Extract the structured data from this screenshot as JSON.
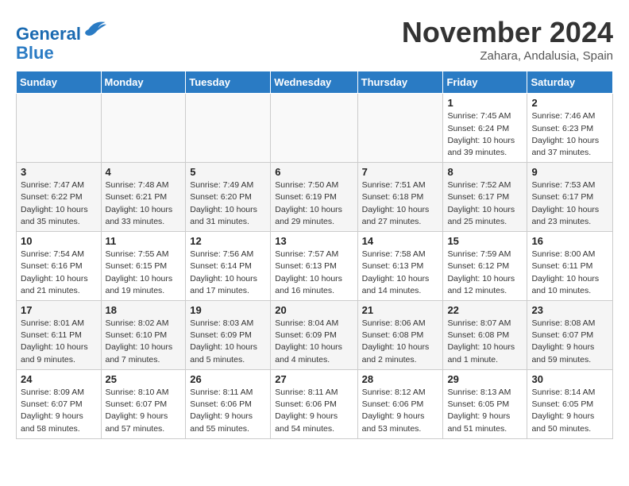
{
  "logo": {
    "line1": "General",
    "line2": "Blue"
  },
  "title": "November 2024",
  "location": "Zahara, Andalusia, Spain",
  "days_header": [
    "Sunday",
    "Monday",
    "Tuesday",
    "Wednesday",
    "Thursday",
    "Friday",
    "Saturday"
  ],
  "weeks": [
    [
      {
        "num": "",
        "info": ""
      },
      {
        "num": "",
        "info": ""
      },
      {
        "num": "",
        "info": ""
      },
      {
        "num": "",
        "info": ""
      },
      {
        "num": "",
        "info": ""
      },
      {
        "num": "1",
        "info": "Sunrise: 7:45 AM\nSunset: 6:24 PM\nDaylight: 10 hours\nand 39 minutes."
      },
      {
        "num": "2",
        "info": "Sunrise: 7:46 AM\nSunset: 6:23 PM\nDaylight: 10 hours\nand 37 minutes."
      }
    ],
    [
      {
        "num": "3",
        "info": "Sunrise: 7:47 AM\nSunset: 6:22 PM\nDaylight: 10 hours\nand 35 minutes."
      },
      {
        "num": "4",
        "info": "Sunrise: 7:48 AM\nSunset: 6:21 PM\nDaylight: 10 hours\nand 33 minutes."
      },
      {
        "num": "5",
        "info": "Sunrise: 7:49 AM\nSunset: 6:20 PM\nDaylight: 10 hours\nand 31 minutes."
      },
      {
        "num": "6",
        "info": "Sunrise: 7:50 AM\nSunset: 6:19 PM\nDaylight: 10 hours\nand 29 minutes."
      },
      {
        "num": "7",
        "info": "Sunrise: 7:51 AM\nSunset: 6:18 PM\nDaylight: 10 hours\nand 27 minutes."
      },
      {
        "num": "8",
        "info": "Sunrise: 7:52 AM\nSunset: 6:17 PM\nDaylight: 10 hours\nand 25 minutes."
      },
      {
        "num": "9",
        "info": "Sunrise: 7:53 AM\nSunset: 6:17 PM\nDaylight: 10 hours\nand 23 minutes."
      }
    ],
    [
      {
        "num": "10",
        "info": "Sunrise: 7:54 AM\nSunset: 6:16 PM\nDaylight: 10 hours\nand 21 minutes."
      },
      {
        "num": "11",
        "info": "Sunrise: 7:55 AM\nSunset: 6:15 PM\nDaylight: 10 hours\nand 19 minutes."
      },
      {
        "num": "12",
        "info": "Sunrise: 7:56 AM\nSunset: 6:14 PM\nDaylight: 10 hours\nand 17 minutes."
      },
      {
        "num": "13",
        "info": "Sunrise: 7:57 AM\nSunset: 6:13 PM\nDaylight: 10 hours\nand 16 minutes."
      },
      {
        "num": "14",
        "info": "Sunrise: 7:58 AM\nSunset: 6:13 PM\nDaylight: 10 hours\nand 14 minutes."
      },
      {
        "num": "15",
        "info": "Sunrise: 7:59 AM\nSunset: 6:12 PM\nDaylight: 10 hours\nand 12 minutes."
      },
      {
        "num": "16",
        "info": "Sunrise: 8:00 AM\nSunset: 6:11 PM\nDaylight: 10 hours\nand 10 minutes."
      }
    ],
    [
      {
        "num": "17",
        "info": "Sunrise: 8:01 AM\nSunset: 6:11 PM\nDaylight: 10 hours\nand 9 minutes."
      },
      {
        "num": "18",
        "info": "Sunrise: 8:02 AM\nSunset: 6:10 PM\nDaylight: 10 hours\nand 7 minutes."
      },
      {
        "num": "19",
        "info": "Sunrise: 8:03 AM\nSunset: 6:09 PM\nDaylight: 10 hours\nand 5 minutes."
      },
      {
        "num": "20",
        "info": "Sunrise: 8:04 AM\nSunset: 6:09 PM\nDaylight: 10 hours\nand 4 minutes."
      },
      {
        "num": "21",
        "info": "Sunrise: 8:06 AM\nSunset: 6:08 PM\nDaylight: 10 hours\nand 2 minutes."
      },
      {
        "num": "22",
        "info": "Sunrise: 8:07 AM\nSunset: 6:08 PM\nDaylight: 10 hours\nand 1 minute."
      },
      {
        "num": "23",
        "info": "Sunrise: 8:08 AM\nSunset: 6:07 PM\nDaylight: 9 hours\nand 59 minutes."
      }
    ],
    [
      {
        "num": "24",
        "info": "Sunrise: 8:09 AM\nSunset: 6:07 PM\nDaylight: 9 hours\nand 58 minutes."
      },
      {
        "num": "25",
        "info": "Sunrise: 8:10 AM\nSunset: 6:07 PM\nDaylight: 9 hours\nand 57 minutes."
      },
      {
        "num": "26",
        "info": "Sunrise: 8:11 AM\nSunset: 6:06 PM\nDaylight: 9 hours\nand 55 minutes."
      },
      {
        "num": "27",
        "info": "Sunrise: 8:11 AM\nSunset: 6:06 PM\nDaylight: 9 hours\nand 54 minutes."
      },
      {
        "num": "28",
        "info": "Sunrise: 8:12 AM\nSunset: 6:06 PM\nDaylight: 9 hours\nand 53 minutes."
      },
      {
        "num": "29",
        "info": "Sunrise: 8:13 AM\nSunset: 6:05 PM\nDaylight: 9 hours\nand 51 minutes."
      },
      {
        "num": "30",
        "info": "Sunrise: 8:14 AM\nSunset: 6:05 PM\nDaylight: 9 hours\nand 50 minutes."
      }
    ]
  ]
}
